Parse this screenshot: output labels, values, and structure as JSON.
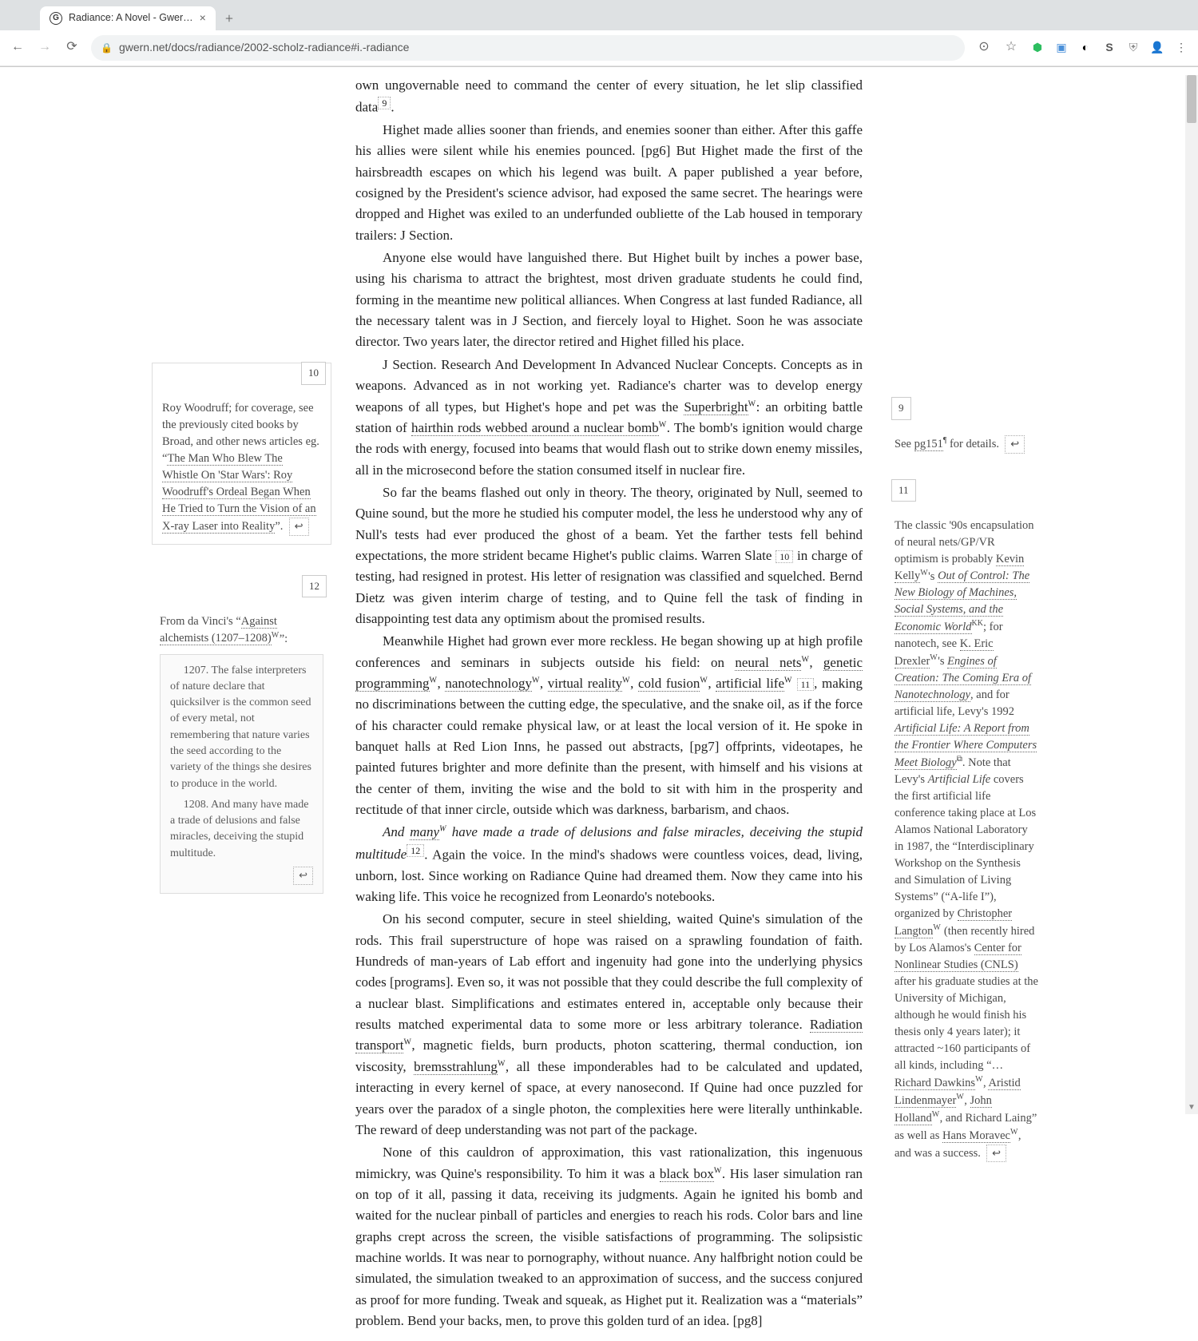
{
  "browser": {
    "tab_title": "Radiance: A Novel - Gwer…",
    "url": "gwern.net/docs/radiance/2002-scholz-radiance#i.-radiance"
  },
  "sidenotes": {
    "sn9": {
      "num": "9",
      "text_a": "See ",
      "link": "pg151",
      "sup": "¶",
      "text_b": " for details."
    },
    "sn10": {
      "num": "10",
      "intro": "Roy Woodruff; for coverage, see the previously cited books by Broad, and other news articles eg. ",
      "q1": "“",
      "link": "The Man Who Blew The Whistle On 'Star Wars': Roy Woodruff's Ordeal Began When He Tried to Turn the Vision of an X-ray Laser into Reality",
      "q2": "”."
    },
    "sn12": {
      "num": "12",
      "intro": "From da Vinci's ",
      "q1": "“",
      "link": "Against alchemists (1207–1208)",
      "sup": "W",
      "q2": "”:",
      "quote1": "1207. The false interpreters of nature declare that quicksilver is the common seed of every metal, not remembering that nature varies the seed according to the variety of the things she desires to produce in the world.",
      "quote2": "1208. And many have made a trade of delusions and false miracles, deceiving the stupid multitude."
    },
    "sn11": {
      "num": "11",
      "t1": "The classic '90s encapsulation of neural nets/GP/VR optimism is probably ",
      "kelly": "Kevin Kelly",
      "ws": "W",
      "s1": "'s ",
      "book1": "Out of Control: The New Biology of Machines, Social Systems, and the Economic World",
      "sup1": "KK",
      "t2": "; for nanotech, see ",
      "drexler": "K. Eric Drexler",
      "s2": "'s ",
      "book2": "Engines of Creation: The Coming Era of Nanotechnology",
      "t3": ", and for artificial life, Levy's 1992 ",
      "book3": "Artificial Life: A Report from the Frontier Where Computers Meet Biology",
      "sup3": "⧉",
      "t4": ". Note that Levy's ",
      "alife_ital": "Artificial Life",
      "t5": " covers the first artificial life conference taking place at Los Alamos National Laboratory in 1987, the “Interdisciplinary Workshop on the Synthesis and Simulation of Living Systems” (“A-life I”), organized by ",
      "langton": "Christopher Langton",
      "t6": " (then recently hired by Los Alamos's ",
      "cnls": "Center for Nonlinear Studies (CNLS)",
      "t7": " after his graduate studies at the University of Michigan, although he would finish his thesis only 4 years later); it attracted ~160 participants of all kinds, including “…",
      "dawkins": "Richard Dawkins",
      "comma1": ", ",
      "lindenmayer": "Aristid Lindenmayer",
      "comma2": ", ",
      "holland": "John Holland",
      "t8": ", and Richard Laing” as well as ",
      "moravec": "Hans Moravec",
      "t9": ", and was a success."
    }
  },
  "main": {
    "p0": "own ungovernable need to command the center of every situation, he let slip classified data",
    "p0_sup": "9",
    "p0_end": ".",
    "p1": "Highet made allies sooner than friends, and enemies sooner than either. After this gaffe his allies were silent while his enemies pounced. [pg6] But Highet made the first of the hairsbreadth escapes on which his legend was built. A paper published a year before, cosigned by the President's science advisor, had exposed the same secret. The hearings were dropped and Highet was exiled to an underfunded oubliette of the Lab housed in temporary trailers: J Section.",
    "p2": "Anyone else would have languished there. But Highet built by inches a power base, using his charisma to attract the brightest, most driven graduate students he could find, forming in the meantime new political alliances. When Congress at last funded Radiance, all the necessary talent was in J Section, and fiercely loyal to Highet. Soon he was associate director. Two years later, the director retired and Highet filled his place.",
    "p3a": "J Section. Research And Development In Advanced Nuclear Concepts. Concepts as in weapons. Advanced as in not working yet. Radiance's charter was to develop energy weapons of all types, but Highet's hope and pet was the ",
    "p3_link1": "Superbright",
    "p3a2": ": an orbiting battle station of ",
    "p3_link2": "hairthin rods webbed around a nuclear bomb",
    "p3b": ". The bomb's ignition would charge the rods with energy, focused into beams that would flash out to strike down enemy missiles, all in the microsecond before the station consumed itself in nuclear fire.",
    "p4a": "So far the beams flashed out only in theory. The theory, originated by Null, seemed to Quine sound, but the more he studied his computer model, the less he understood why any of Null's tests had ever produced the ghost of a beam. Yet the farther tests fell behind expectations, the more strident became Highet's public claims. Warren Slate",
    "p4_fn": "10",
    "p4b": " in charge of testing, had resigned in protest. His letter of resignation was classified and squelched. Bernd Dietz was given interim charge of testing, and to Quine fell the task of finding in disappointing test data any optimism about the promised results.",
    "p5a": "Meanwhile Highet had grown ever more reckless. He began showing up at high profile conferences and seminars in subjects outside his field: on ",
    "p5_l1": "neural nets",
    "c1": ", ",
    "p5_l2": "genetic programming",
    "c2": ", ",
    "p5_l3": "nanotechnology",
    "c3": ", ",
    "p5_l4": "virtual reality",
    "c4": ", ",
    "p5_l5": "cold fusion",
    "c5": ", ",
    "p5_l6": "artificial life",
    "p5_fn": "11",
    "p5b": ", making no discriminations between the cutting edge, the speculative, and the snake oil, as if the force of his character could remake physical law, or at least the local version of it. He spoke in banquet halls at Red Lion Inns, he passed out abstracts, [pg7] offprints, videotapes, he painted futures brighter and more definite than the present, with himself and his visions at the center of them, inviting the wise and the bold to sit with him in the prosperity and rectitude of that inner circle, outside which was darkness, barbarism, and chaos.",
    "p6_ital_a": "And ",
    "p6_many": "many",
    "p6_ital_b": " have made a trade of delusions and false miracles, deceiving the stupid multitude",
    "p6_fn": "12",
    "p6b": ". Again the voice. In the mind's shadows were countless voices, dead, living, unborn, lost. Since working on Radiance Quine had dreamed them. Now they came into his waking life. This voice he recognized from Leonardo's notebooks.",
    "p7a": "On his second computer, secure in steel shielding, waited Quine's simulation of the rods. This frail superstructure of hope was raised on a sprawling foundation of faith. Hundreds of man-years of Lab effort and ingenuity had gone into the underlying physics codes [programs]. Even so, it was not possible that they could describe the full complexity of a nuclear blast. Simplifications and estimates entered in, acceptable only because their results matched experimental data to some more or less arbitrary tolerance. ",
    "p7_l1": "Radiation transport",
    "p7b": ", magnetic fields, burn products, photon scattering, thermal conduction, ion viscosity, ",
    "p7_l2": "bremsstrahlung",
    "p7c": ", all these imponderables had to be calculated and updated, interacting in every kernel of space, at every nanosecond. If Quine had once puzzled for years over the paradox of a single photon, the complexities here were literally unthinkable. The reward of deep understanding was not part of the package.",
    "p8a": "None of this cauldron of approximation, this vast rationalization, this ingenuous mimickry, was Quine's responsibility. To him it was a ",
    "p8_l1": "black box",
    "p8b": ". His laser simulation ran on top of it all, passing it data, receiving its judgments. Again he ignited his bomb and waited for the nuclear pinball of particles and energies to reach his rods. Color bars and line graphs crept across the screen, the visible satisfactions of programming. The solipsistic machine worlds. It was near to pornography, without nuance. Any halfbright notion could be simulated, the simulation tweaked to an approximation of success, and the success conjured as proof for more funding. Tweak and squeak, as Highet put it. Realization was a “materials” problem. Bend your backs, men, to prove this golden turd of an idea. [pg8]"
  }
}
